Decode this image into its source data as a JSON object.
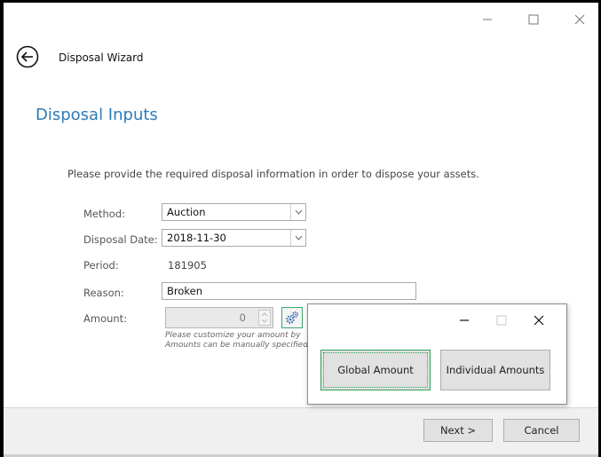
{
  "window": {
    "title": "Disposal Wizard",
    "page_title": "Disposal Inputs",
    "instructions": "Please provide the required disposal information in order to dispose your assets."
  },
  "title_bar": {
    "minimize": "minimize-icon",
    "maximize": "maximize-icon",
    "close": "close-icon"
  },
  "form": {
    "method": {
      "label": "Method:",
      "value": "Auction"
    },
    "disposal_date": {
      "label": "Disposal Date:",
      "value": "2018-11-30"
    },
    "period": {
      "label": "Period:",
      "value": "181905"
    },
    "reason": {
      "label": "Reason:",
      "value": "Broken"
    },
    "amount": {
      "label": "Amount:",
      "value": "0",
      "hint_line1": "Please customize your amount by",
      "hint_line2": "Amounts can be manually specified"
    }
  },
  "popup": {
    "global_amount": "Global Amount",
    "individual_amounts": "Individual Amounts"
  },
  "footer": {
    "next": "Next >",
    "cancel": "Cancel"
  },
  "colors": {
    "accent": "#2d7bb8",
    "focus": "#2f9e58"
  }
}
